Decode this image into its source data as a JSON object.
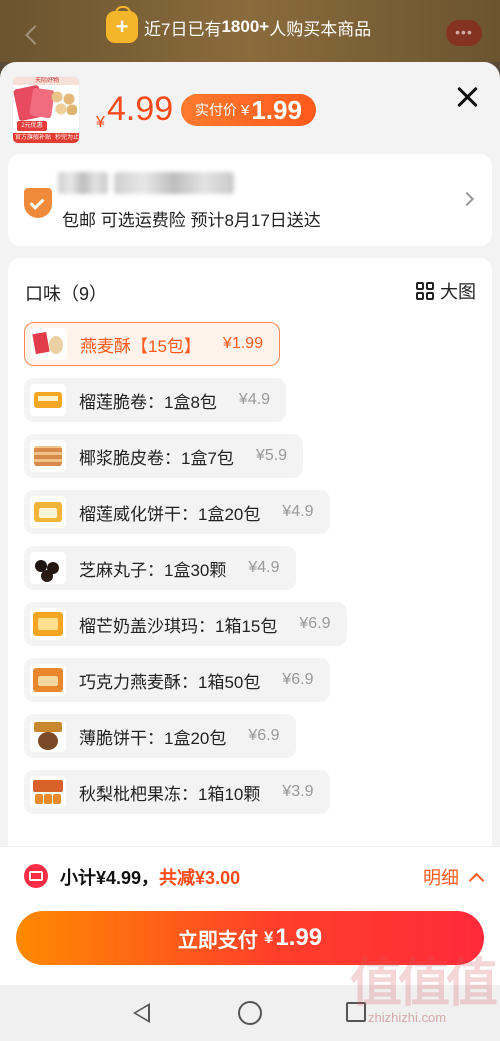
{
  "toast": {
    "prefix": "近7日已有",
    "count": "1800+",
    "suffix": "人购买本商品"
  },
  "product": {
    "thumb_top": "天际好物",
    "thumb_tag": "2元优惠",
    "thumb_bottom_left": "官方旗舰补贴",
    "thumb_bottom_right": "秒完为止",
    "currency": "¥",
    "price": "4.99",
    "real_price_label": "实付价",
    "real_price_currency": "¥",
    "real_price": "1.99"
  },
  "address": {
    "shipping_info": "包邮 可选运费险 预计8月17日送达"
  },
  "flavor": {
    "title": "口味（9）",
    "big_image_label": "大图",
    "options": [
      {
        "name": "燕麦酥【15包】",
        "price": "¥1.99",
        "icon": "oat-crisp-thumb",
        "selected": true
      },
      {
        "name": "榴莲脆卷：1盒8包",
        "price": "¥4.9",
        "icon": "durian-roll-thumb",
        "selected": false
      },
      {
        "name": "椰浆脆皮卷：1盒7包",
        "price": "¥5.9",
        "icon": "coconut-roll-thumb",
        "selected": false
      },
      {
        "name": "榴莲威化饼干：1盒20包",
        "price": "¥4.9",
        "icon": "durian-wafer-thumb",
        "selected": false
      },
      {
        "name": "芝麻丸子：1盒30颗",
        "price": "¥4.9",
        "icon": "sesame-ball-thumb",
        "selected": false
      },
      {
        "name": "榴芒奶盖沙琪玛：1箱15包",
        "price": "¥6.9",
        "icon": "sachima-thumb",
        "selected": false
      },
      {
        "name": "巧克力燕麦酥：1箱50包",
        "price": "¥6.9",
        "icon": "choco-oat-thumb",
        "selected": false
      },
      {
        "name": "薄脆饼干：1盒20包",
        "price": "¥6.9",
        "icon": "thin-cracker-thumb",
        "selected": false
      },
      {
        "name": "秋梨枇杷果冻：1箱10颗",
        "price": "¥3.9",
        "icon": "pear-jelly-thumb",
        "selected": false
      }
    ]
  },
  "summary": {
    "subtotal": "小计¥4.99，",
    "discount": "共减¥3.00",
    "detail_label": "明细"
  },
  "pay": {
    "label": "立即支付",
    "currency": "¥",
    "amount": "1.99"
  },
  "watermark": {
    "glyphs": "值值值",
    "url": "zhizhizhi.com"
  },
  "colors": {
    "accent": "#ff5a1c",
    "price_red": "#ff4a1a",
    "subtotal_icon": "#ff2d46",
    "pay_gradient_start": "#ff8a00",
    "pay_gradient_end": "#ff2a3a"
  }
}
